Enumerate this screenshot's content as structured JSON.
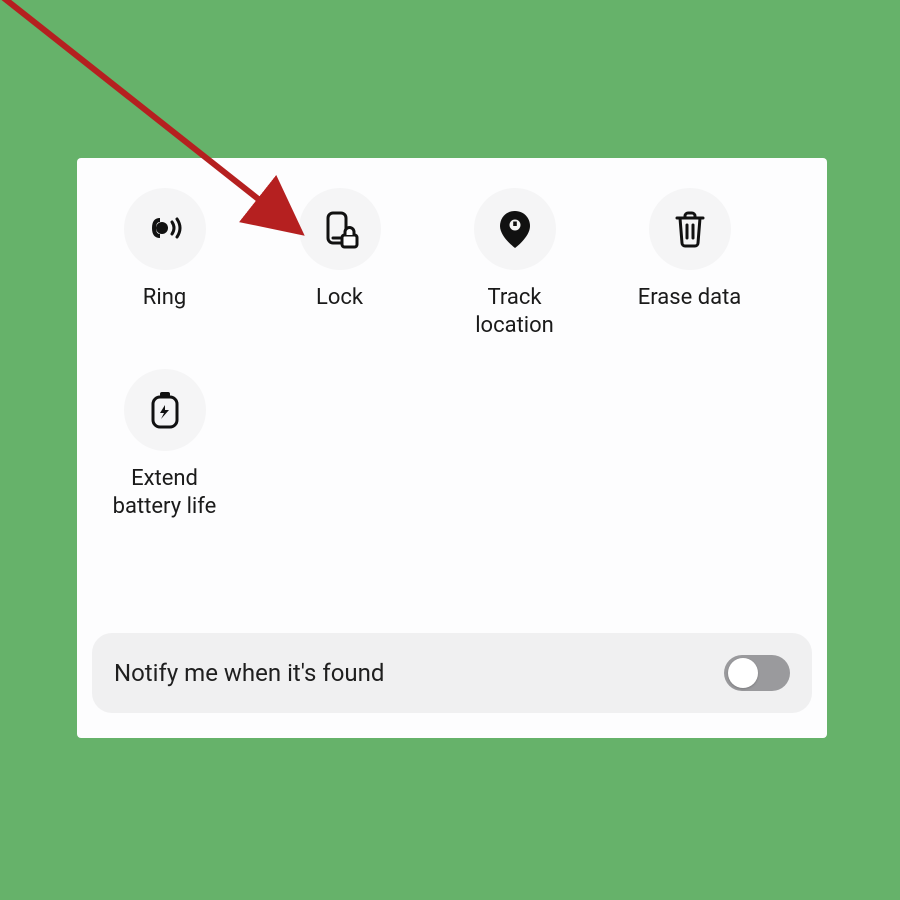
{
  "actions": [
    {
      "id": "ring",
      "label": "Ring"
    },
    {
      "id": "lock",
      "label": "Lock"
    },
    {
      "id": "track",
      "label": "Track\nlocation"
    },
    {
      "id": "erase",
      "label": "Erase data"
    },
    {
      "id": "battery",
      "label": "Extend\nbattery life"
    }
  ],
  "toggle": {
    "label": "Notify me when it's found",
    "state": "off"
  },
  "annotation": {
    "type": "arrow",
    "target": "lock",
    "color": "#b52020"
  }
}
